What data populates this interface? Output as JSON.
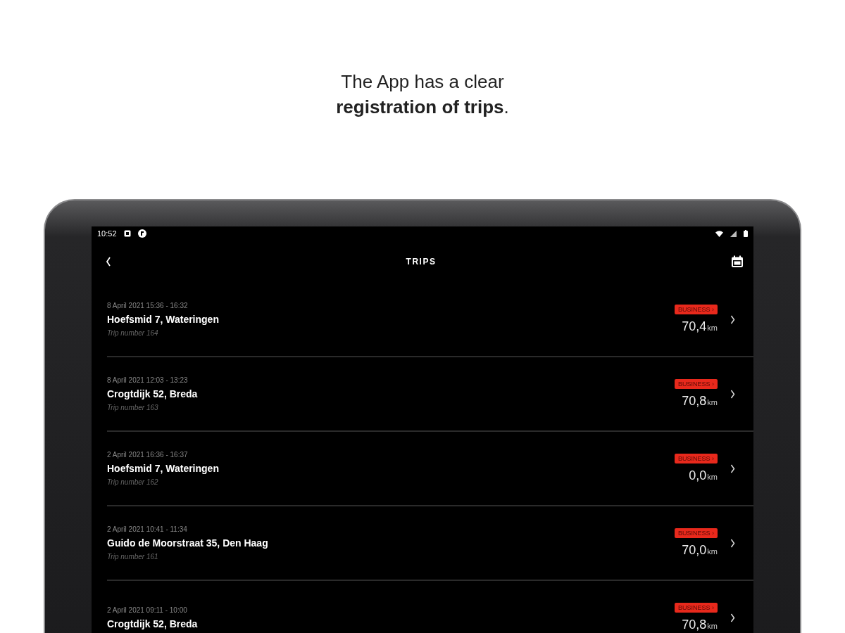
{
  "headline": {
    "lines": [
      "The App has a clear",
      "**registration of trips**."
    ]
  },
  "status_bar": {
    "time": "10:52"
  },
  "header": {
    "title": "TRIPS"
  },
  "trips": [
    {
      "date": "8 April 2021  15:36 - 16:32",
      "address": "Hoefsmid 7, Wateringen",
      "trip_number": "Trip number 164",
      "badge": "BUSINESS ›",
      "distance": "70,4",
      "unit": "km"
    },
    {
      "date": "8 April 2021  12:03 - 13:23",
      "address": "Crogtdijk 52, Breda",
      "trip_number": "Trip number 163",
      "badge": "BUSINESS ›",
      "distance": "70,8",
      "unit": "km"
    },
    {
      "date": "2 April 2021  16:36 - 16:37",
      "address": "Hoefsmid 7, Wateringen",
      "trip_number": "Trip number 162",
      "badge": "BUSINESS ›",
      "distance": "0,0",
      "unit": "km"
    },
    {
      "date": "2 April 2021  10:41 - 11:34",
      "address": "Guido de Moorstraat 35, Den Haag",
      "trip_number": "Trip number 161",
      "badge": "BUSINESS ›",
      "distance": "70,0",
      "unit": "km"
    },
    {
      "date": "2 April 2021  09:11 - 10:00",
      "address": "Crogtdijk 52, Breda",
      "badge": "BUSINESS ›",
      "distance": "70,8",
      "unit": "km"
    }
  ]
}
